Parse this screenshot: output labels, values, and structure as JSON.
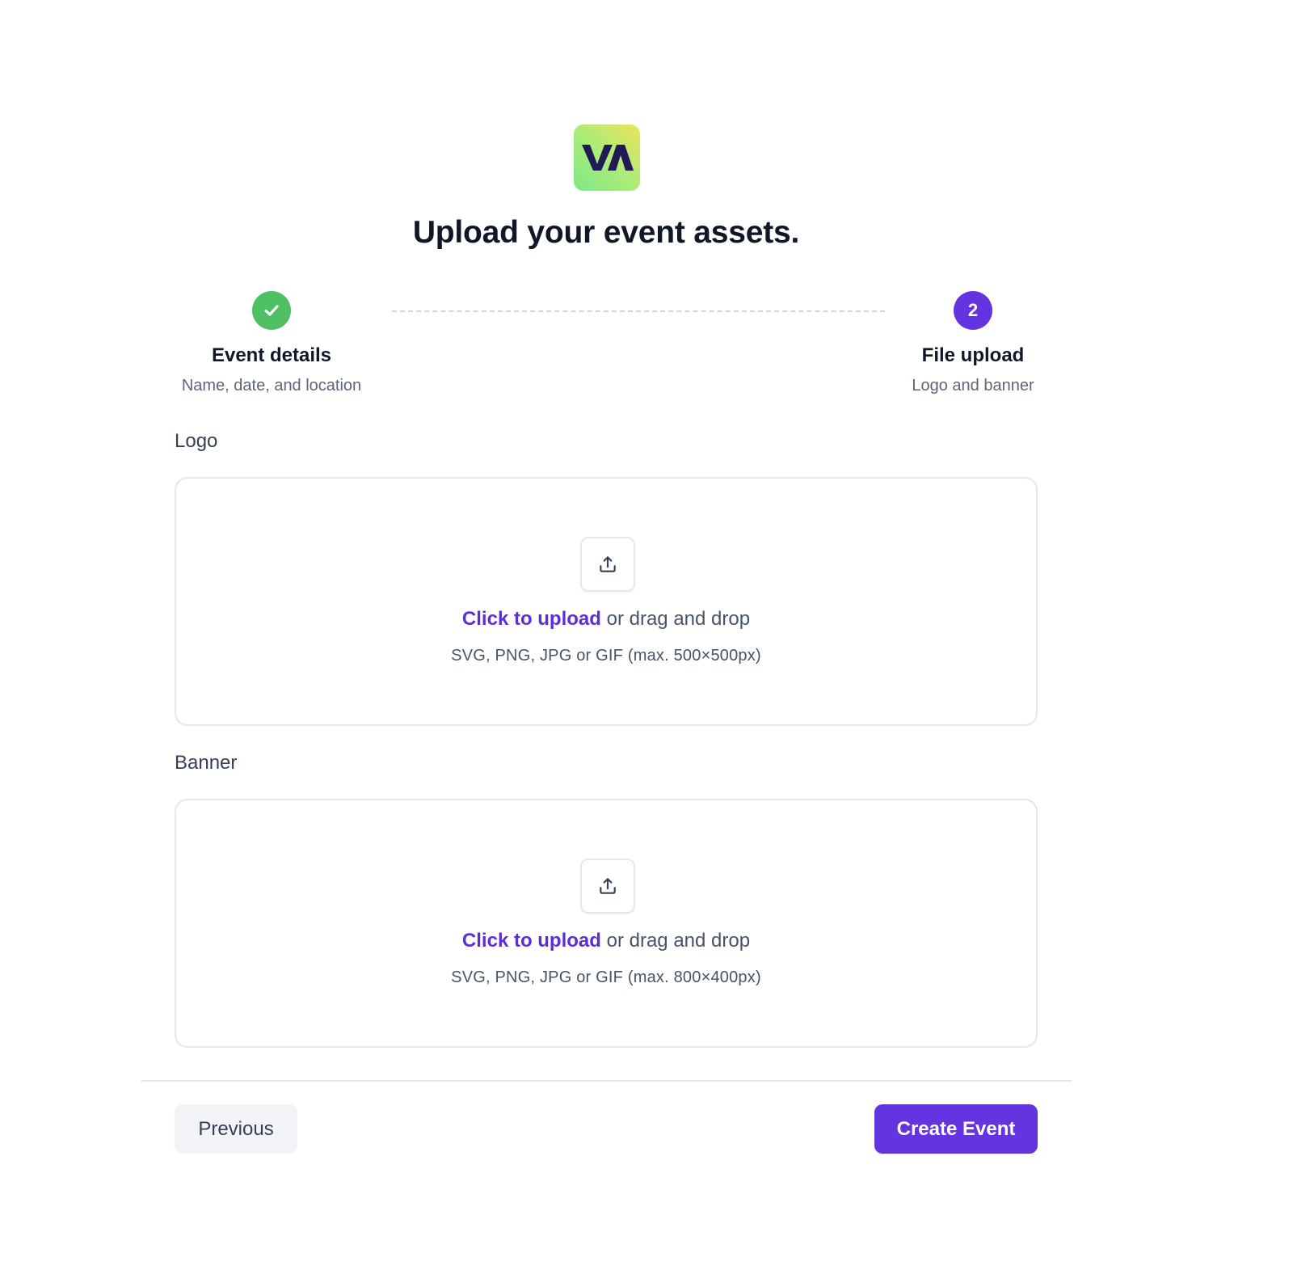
{
  "brand": {
    "logo_text": "VA",
    "logo_icon": "va-logo-icon"
  },
  "header": {
    "title": "Upload your event assets."
  },
  "stepper": {
    "steps": [
      {
        "title": "Event details",
        "subtitle": "Name, date, and location",
        "status": "completed",
        "icon": "check-icon"
      },
      {
        "number": "2",
        "title": "File upload",
        "subtitle": "Logo and banner",
        "status": "active"
      }
    ]
  },
  "fields": {
    "logo": {
      "label": "Logo",
      "upload_link": "Click to upload",
      "upload_rest": " or drag and drop",
      "hint": "SVG, PNG, JPG or GIF (max. 500×500px)",
      "icon": "upload-icon"
    },
    "banner": {
      "label": "Banner",
      "upload_link": "Click to upload",
      "upload_rest": " or drag and drop",
      "hint": "SVG, PNG, JPG or GIF (max. 800×400px)",
      "icon": "upload-icon"
    }
  },
  "footer": {
    "previous_label": "Previous",
    "create_label": "Create Event"
  },
  "colors": {
    "accent": "#6434e0",
    "link": "#5b2fd2",
    "success": "#4fbf63",
    "border": "#e4e7ec",
    "text_primary": "#101828",
    "text_secondary": "#5d6679"
  }
}
